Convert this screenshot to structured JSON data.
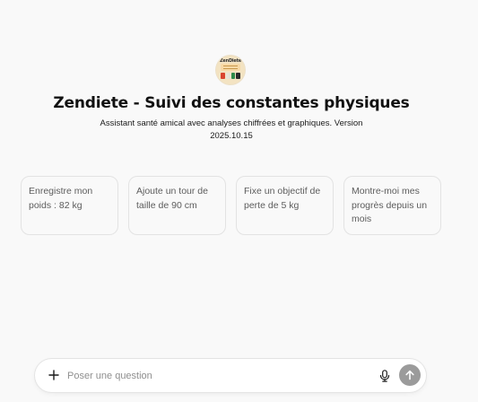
{
  "assistant": {
    "logo_text": "ZenDiete",
    "title": "Zendiete - Suivi des constantes physiques",
    "description": "Assistant santé amical avec analyses chiffrées et graphiques. Version 2025.10.15"
  },
  "suggestions": [
    {
      "label": "Enregistre mon poids : 82 kg"
    },
    {
      "label": "Ajoute un tour de taille de 90 cm"
    },
    {
      "label": "Fixe un objectif de perte de 5 kg"
    },
    {
      "label": "Montre-moi mes progrès depuis un mois"
    }
  ],
  "composer": {
    "placeholder": "Poser une question",
    "value": "",
    "icons": {
      "attach": "plus-icon",
      "voice": "microphone-icon",
      "send": "arrow-up-icon"
    },
    "send_button_color": "#9b9b9b"
  }
}
